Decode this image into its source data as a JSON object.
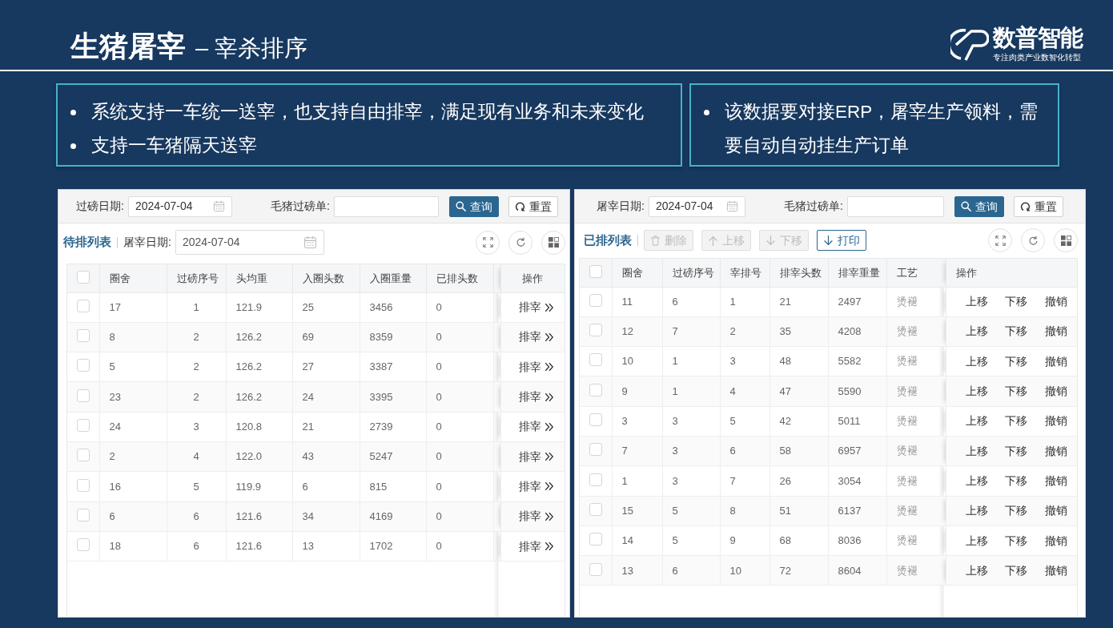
{
  "header": {
    "title": "生猪屠宰",
    "subtitle": "– 宰杀排序",
    "logo": {
      "name": "数普智能",
      "tagline": "专注肉类产业数智化转型"
    }
  },
  "notes": [
    {
      "items": [
        "系统支持一车统一送宰，也支持自由排宰，满足现有业务和未来变化",
        "支持一车猪隔天送宰"
      ]
    },
    {
      "items": [
        "该数据要对接ERP，屠宰生产领料，需要自动自动挂生产订单"
      ]
    }
  ],
  "panels": [
    {
      "filters": [
        {
          "kind": "date",
          "label": "过磅日期:",
          "value": "2024-07-04"
        },
        {
          "kind": "text",
          "label": "毛猪过磅单:"
        }
      ],
      "search_buttons": [
        {
          "kind": "search",
          "label": "查询"
        },
        {
          "kind": "reset",
          "label": "重置"
        }
      ],
      "list_title": "待排列表",
      "toolbar": [
        {
          "kind": "date",
          "label": "屠宰日期:",
          "value": "2024-07-04"
        }
      ],
      "table": {
        "all_checked": false,
        "columns": [
          "圈舍",
          "过磅序号",
          "头均重",
          "入圈头数",
          "入圈重量",
          "已排头数"
        ],
        "cut_column": true,
        "action_column": {
          "label": "操作",
          "kind": "forward"
        },
        "rows": [
          {
            "checked": false,
            "cells": [
              "17",
              "1",
              "121.9",
              "25",
              "3456",
              "0"
            ],
            "actions": [
              "排宰"
            ]
          },
          {
            "checked": false,
            "cells": [
              "8",
              "2",
              "126.2",
              "69",
              "8359",
              "0"
            ],
            "actions": [
              "排宰"
            ]
          },
          {
            "checked": false,
            "cells": [
              "5",
              "2",
              "126.2",
              "27",
              "3387",
              "0"
            ],
            "actions": [
              "排宰"
            ]
          },
          {
            "checked": false,
            "cells": [
              "23",
              "2",
              "126.2",
              "24",
              "3395",
              "0"
            ],
            "actions": [
              "排宰"
            ]
          },
          {
            "checked": false,
            "cells": [
              "24",
              "3",
              "120.8",
              "21",
              "2739",
              "0"
            ],
            "actions": [
              "排宰"
            ]
          },
          {
            "checked": false,
            "cells": [
              "2",
              "4",
              "122.0",
              "43",
              "5247",
              "0"
            ],
            "actions": [
              "排宰"
            ]
          },
          {
            "checked": false,
            "cells": [
              "16",
              "5",
              "119.9",
              "6",
              "815",
              "0"
            ],
            "actions": [
              "排宰"
            ]
          },
          {
            "checked": false,
            "cells": [
              "6",
              "6",
              "121.6",
              "34",
              "4169",
              "0"
            ],
            "actions": [
              "排宰"
            ]
          },
          {
            "checked": false,
            "cells": [
              "18",
              "6",
              "121.6",
              "13",
              "1702",
              "0"
            ],
            "actions": [
              "排宰"
            ]
          }
        ]
      }
    },
    {
      "filters": [
        {
          "kind": "date",
          "label": "屠宰日期:",
          "value": "2024-07-04"
        },
        {
          "kind": "text",
          "label": "毛猪过磅单:"
        }
      ],
      "search_buttons": [
        {
          "kind": "search",
          "label": "查询"
        },
        {
          "kind": "reset",
          "label": "重置"
        }
      ],
      "list_title": "已排列表",
      "toolbar": [
        {
          "kind": "delete",
          "label": "删除",
          "disabled": true
        },
        {
          "kind": "move-up",
          "label": "上移",
          "disabled": true
        },
        {
          "kind": "move-down",
          "label": "下移",
          "disabled": true
        },
        {
          "kind": "print",
          "label": "打印",
          "disabled": false
        }
      ],
      "table": {
        "all_checked": false,
        "columns": [
          "圈舍",
          "过磅序号",
          "宰排号",
          "排宰头数",
          "排宰重量",
          "工艺"
        ],
        "action_column": {
          "label": "操作",
          "kind": "links"
        },
        "rows": [
          {
            "checked": false,
            "cells": [
              "11",
              "6",
              "1",
              "21",
              "2497",
              "烫褪"
            ],
            "actions": [
              "上移",
              "下移",
              "撤销"
            ]
          },
          {
            "checked": false,
            "cells": [
              "12",
              "7",
              "2",
              "35",
              "4208",
              "烫褪"
            ],
            "actions": [
              "上移",
              "下移",
              "撤销"
            ]
          },
          {
            "checked": false,
            "cells": [
              "10",
              "1",
              "3",
              "48",
              "5582",
              "烫褪"
            ],
            "actions": [
              "上移",
              "下移",
              "撤销"
            ]
          },
          {
            "checked": false,
            "cells": [
              "9",
              "1",
              "4",
              "47",
              "5590",
              "烫褪"
            ],
            "actions": [
              "上移",
              "下移",
              "撤销"
            ]
          },
          {
            "checked": false,
            "cells": [
              "3",
              "3",
              "5",
              "42",
              "5011",
              "烫褪"
            ],
            "actions": [
              "上移",
              "下移",
              "撤销"
            ]
          },
          {
            "checked": false,
            "cells": [
              "7",
              "3",
              "6",
              "58",
              "6957",
              "烫褪"
            ],
            "actions": [
              "上移",
              "下移",
              "撤销"
            ]
          },
          {
            "checked": false,
            "cells": [
              "1",
              "3",
              "7",
              "26",
              "3054",
              "烫褪"
            ],
            "actions": [
              "上移",
              "下移",
              "撤销"
            ]
          },
          {
            "checked": false,
            "cells": [
              "15",
              "5",
              "8",
              "51",
              "6137",
              "烫褪"
            ],
            "actions": [
              "上移",
              "下移",
              "撤销"
            ]
          },
          {
            "checked": false,
            "cells": [
              "14",
              "5",
              "9",
              "68",
              "8036",
              "烫褪"
            ],
            "actions": [
              "上移",
              "下移",
              "撤销"
            ]
          },
          {
            "checked": false,
            "cells": [
              "13",
              "6",
              "10",
              "72",
              "8604",
              "烫褪"
            ],
            "actions": [
              "上移",
              "下移",
              "撤销"
            ]
          }
        ]
      }
    }
  ]
}
